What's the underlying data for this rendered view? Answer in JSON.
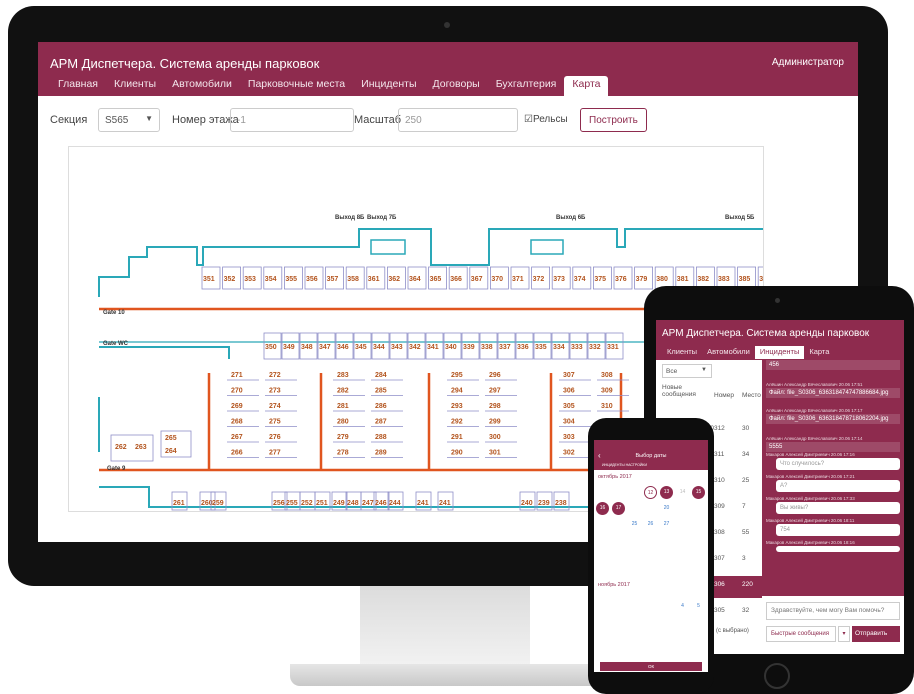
{
  "desktop": {
    "app_title": "АРМ Диспетчера. Система аренды парковок",
    "user": "Администратор",
    "menu": [
      "Главная",
      "Клиенты",
      "Автомобили",
      "Парковочные места",
      "Инциденты",
      "Договоры",
      "Бухгалтерия",
      "Карта"
    ],
    "active_menu": "Карта",
    "toolbar": {
      "section_label": "Секция",
      "section_value": "S565",
      "floor_label": "Номер этажа",
      "floor_value": "-1",
      "scale_label": "Масштаб",
      "scale_value": "250",
      "rails_label": "Рельсы",
      "rails_checked": true,
      "build_button": "Построить"
    },
    "map": {
      "exits": [
        "Выход 8Б",
        "Выход 7Б",
        "Выход 6Б",
        "Выход 5Б"
      ],
      "gates": [
        "Gate 10",
        "Gate WC",
        "Gate 9"
      ],
      "top_row": [
        "351",
        "352",
        "353",
        "354",
        "355",
        "356",
        "357",
        "358",
        "361",
        "362",
        "364",
        "365",
        "366",
        "367",
        "370",
        "371",
        "372",
        "373",
        "374",
        "375",
        "376",
        "379",
        "380",
        "381",
        "382",
        "383",
        "385",
        "386"
      ],
      "mid_row": [
        "350",
        "349",
        "348",
        "347",
        "346",
        "345",
        "344",
        "343",
        "342",
        "341",
        "340",
        "339",
        "338",
        "337",
        "336",
        "335",
        "334",
        "333",
        "332",
        "331"
      ],
      "block_a": [
        [
          "271",
          "272"
        ],
        [
          "270",
          "273"
        ],
        [
          "269",
          "274"
        ],
        [
          "268",
          "275"
        ],
        [
          "267",
          "276"
        ],
        [
          "266",
          "277"
        ]
      ],
      "block_b": [
        [
          "283",
          "284"
        ],
        [
          "282",
          "285"
        ],
        [
          "281",
          "286"
        ],
        [
          "280",
          "287"
        ],
        [
          "279",
          "288"
        ],
        [
          "278",
          "289"
        ]
      ],
      "block_c": [
        [
          "295",
          "296"
        ],
        [
          "294",
          "297"
        ],
        [
          "293",
          "298"
        ],
        [
          "292",
          "299"
        ],
        [
          "291",
          "300"
        ],
        [
          "290",
          "301"
        ]
      ],
      "block_d": [
        [
          "307",
          "308"
        ],
        [
          "306",
          "309"
        ],
        [
          "305",
          "310"
        ],
        [
          "304",
          "311"
        ],
        [
          "303",
          "312"
        ],
        [
          "302",
          ""
        ]
      ],
      "left_pair": [
        "265",
        "264"
      ],
      "far_left": [
        "262",
        "263"
      ],
      "bottom_row": [
        "261",
        "260",
        "259",
        "256",
        "255",
        "252",
        "251",
        "249",
        "248",
        "247",
        "246",
        "244",
        "241",
        "241",
        "240",
        "239",
        "238"
      ]
    },
    "colors": {
      "brand": "#8e2b4e",
      "wall": "#2aa8b8",
      "rail": "#e0551f",
      "spot_label": "#b3541e",
      "spot_line": "#8e8ec8"
    }
  },
  "tablet": {
    "app_title": "АРМ Диспетчера. Система аренды парковок",
    "menu": [
      "Клиенты",
      "Автомобили",
      "Инциденты",
      "Карта"
    ],
    "active_menu": "Инциденты",
    "filter": "Все",
    "headers": {
      "new": "Новые сообщения",
      "number": "Номер",
      "place": "Место"
    },
    "badge": "1",
    "rows": [
      {
        "num": "S0312",
        "place": "30"
      },
      {
        "num": "S0311",
        "place": "34"
      },
      {
        "num": "S0310",
        "place": "25"
      },
      {
        "num": "S0309",
        "place": "7"
      },
      {
        "num": "S0308",
        "place": "55"
      },
      {
        "num": "S0307",
        "place": "3"
      },
      {
        "num": "S0306",
        "place": "220"
      },
      {
        "num": "S0305",
        "place": "32"
      }
    ],
    "footer_note": "(с выбрано)",
    "messages": [
      {
        "text": "456"
      },
      {
        "author": "Алёшин Александр Вячеславович",
        "time": "20.06 17:51",
        "text": "Файл: file_S0306_636318474747886684.jpg"
      },
      {
        "author": "Алёшин Александр Вячеславович",
        "time": "20.06 17:17",
        "text": "Файл: file_S0306_636318478718062204.jpg"
      },
      {
        "author": "Алёшин Александр Вячеславович",
        "time": "20.06 17:14",
        "text": "5555"
      },
      {
        "author": "Макаров Алексей Дмитриевич",
        "time": "20.06 17:16",
        "text": "Что случилось?"
      },
      {
        "author": "Макаров Алексей Дмитриевич",
        "time": "20.06 17:21",
        "text": "А?"
      },
      {
        "author": "Макаров Алексей Дмитриевич",
        "time": "20.06 17:33",
        "text": "Вы живы?"
      },
      {
        "author": "Макаров Алексей Дмитриевич",
        "time": "20.06 18:11",
        "text": "754"
      },
      {
        "author": "Макаров Алексей Дмитриевич",
        "time": "20.06 18:16",
        "text": ""
      }
    ],
    "input_placeholder": "Здравствуйте, чем могу Вам помочь?",
    "quick_button": "Быстрые сообщения",
    "send_button": "Отправить"
  },
  "phone": {
    "title": "Выбор даты",
    "subtitle": "ИНЦИДЕНТЫ НАСТРОЙКИ",
    "month1": "октябрь 2017",
    "month2": "ноябрь 2017",
    "ok": "ОК",
    "days_oct_visible": [
      "12",
      "13",
      "14",
      "15",
      "16",
      "17",
      "20",
      "25",
      "26",
      "27"
    ],
    "days_nov_visible": [
      "4",
      "5"
    ]
  }
}
